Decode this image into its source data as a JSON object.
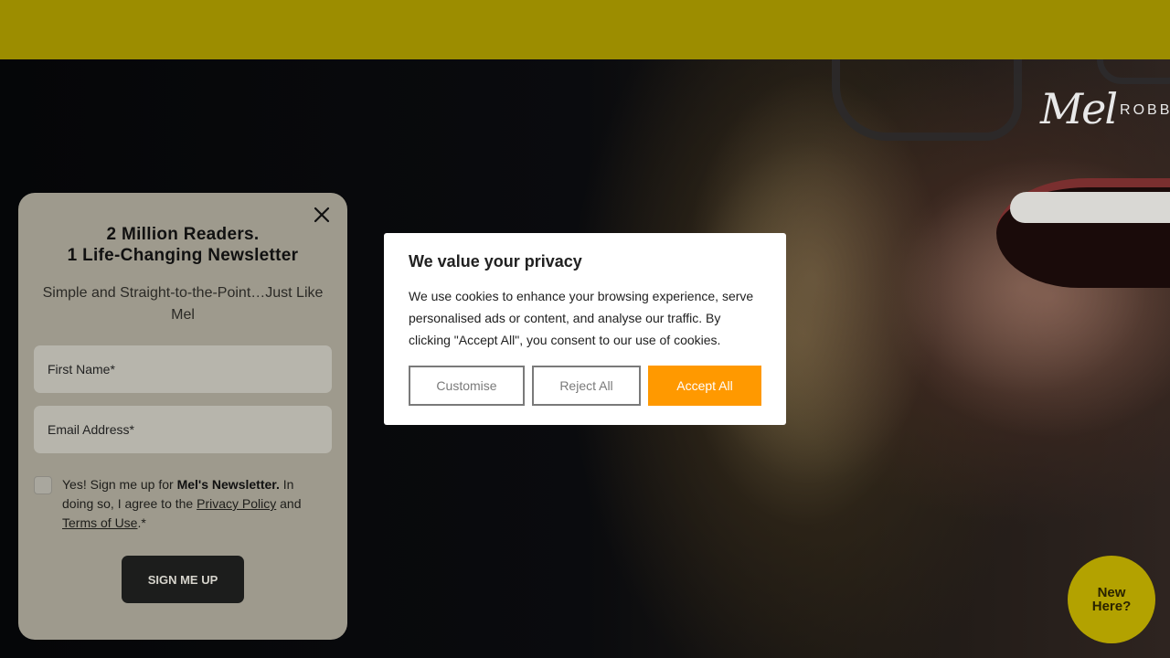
{
  "colors": {
    "topbar": "#9c8d00",
    "panel": "#9e9a8d",
    "accept": "#ff9900",
    "badge": "#b3a200"
  },
  "logo": {
    "script": "Mel",
    "word": "ROBBI"
  },
  "newsletter": {
    "close_icon": "close-icon",
    "title_line1": "2 Million Readers.",
    "title_line2": "1 Life-Changing Newsletter",
    "subtitle": "Simple and Straight-to-the-Point…Just Like Mel",
    "first_name_placeholder": "First Name*",
    "email_placeholder": "Email Address*",
    "consent_prefix": "Yes! Sign me up for ",
    "consent_bold": "Mel's Newsletter.",
    "consent_mid": " In doing so, I agree to the ",
    "privacy_link": "Privacy Policy",
    "consent_and": " and ",
    "terms_link": "Terms of Use",
    "consent_suffix": ".*",
    "submit_label": "SIGN ME UP"
  },
  "cookie": {
    "title": "We value your privacy",
    "body": "We use cookies to enhance your browsing experience, serve personalised ads or content, and analyse our traffic. By clicking \"Accept All\", you consent to our use of cookies.",
    "customise_label": "Customise",
    "reject_label": "Reject All",
    "accept_label": "Accept All"
  },
  "badge": {
    "line1": "New",
    "line2": "Here?"
  }
}
